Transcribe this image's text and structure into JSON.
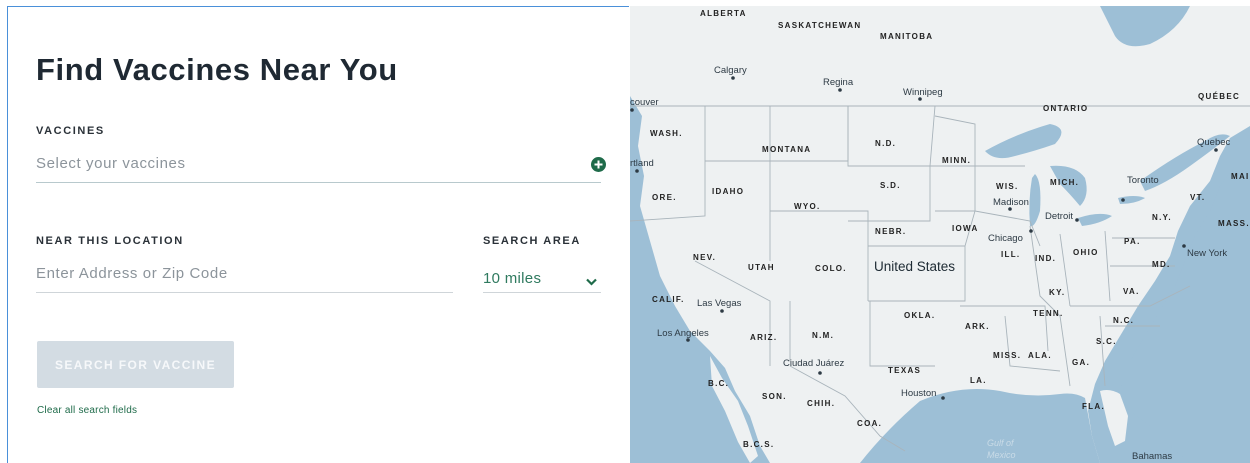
{
  "form": {
    "title": "Find Vaccines Near You",
    "vaccines_label": "VACCINES",
    "vaccines_placeholder": "Select your vaccines",
    "location_label": "NEAR THIS LOCATION",
    "location_placeholder": "Enter Address or Zip Code",
    "search_area_label": "SEARCH AREA",
    "search_area_value": "10 miles",
    "search_button": "SEARCH FOR VACCINE",
    "clear_link": "Clear all search fields"
  },
  "map": {
    "country": "United States",
    "states": [
      "WASH.",
      "MONTANA",
      "N.D.",
      "MINN.",
      "ORE.",
      "IDAHO",
      "WYO.",
      "S.D.",
      "WIS.",
      "MICH.",
      "VT.",
      "NEBR.",
      "IOWA",
      "N.Y.",
      "MASS.",
      "NEV.",
      "UTAH",
      "COLO.",
      "ILL.",
      "IND.",
      "OHIO",
      "PA.",
      "MD.",
      "CALIF.",
      "KY.",
      "VA.",
      "OKLA.",
      "ARK.",
      "TENN.",
      "N.C.",
      "ARIZ.",
      "N.M.",
      "S.C.",
      "MISS.",
      "ALA.",
      "GA.",
      "TEXAS",
      "LA.",
      "FLA.",
      "B.C.",
      "SON.",
      "CHIH.",
      "COA.",
      "B.C.S.",
      "ALBERTA",
      "SASKATCHEWAN",
      "MANITOBA",
      "ONTARIO",
      "QUÉBEC",
      "MAIN"
    ],
    "cities": [
      "Calgary",
      "Regina",
      "Winnipeg",
      "couver",
      "rtland",
      "Quebec",
      "Toronto",
      "Madison",
      "Detroit",
      "Chicago",
      "New York",
      "Las Vegas",
      "Los Angeles",
      "Ciudad Juárez",
      "Houston",
      "Bahamas"
    ],
    "water": [
      "Gulf of",
      "Mexico"
    ],
    "colors": {
      "land": "#eef1f2",
      "water": "#9dbfd6",
      "border": "#a9b4bb"
    }
  }
}
